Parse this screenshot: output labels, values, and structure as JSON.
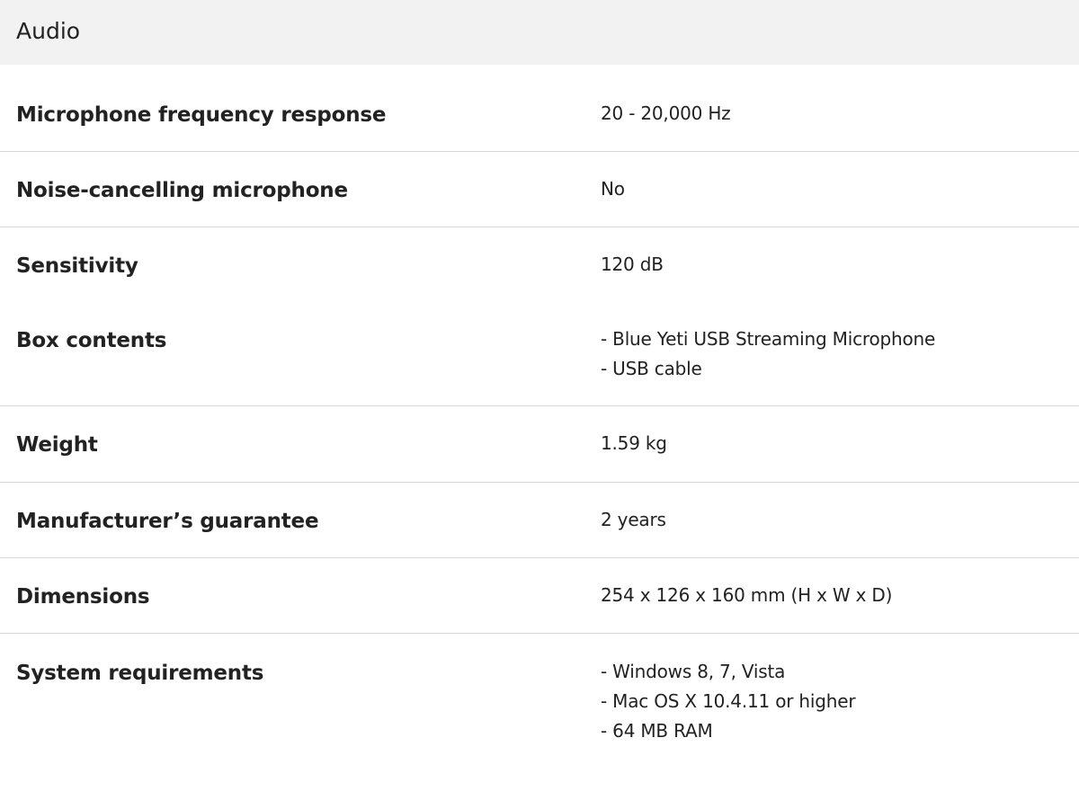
{
  "section": {
    "title": "Audio"
  },
  "specs": [
    {
      "label": "Microphone frequency response",
      "value": "20 - 20,000 Hz"
    },
    {
      "label": "Noise-cancelling microphone",
      "value": "No"
    },
    {
      "label": "Sensitivity",
      "value": "120 dB"
    },
    {
      "label": "Box contents",
      "value": "- Blue Yeti USB Streaming Microphone\n- USB cable"
    },
    {
      "label": "Weight",
      "value": "1.59 kg"
    },
    {
      "label": "Manufacturer’s guarantee",
      "value": "2 years"
    },
    {
      "label": "Dimensions",
      "value": "254 x 126 x 160 mm (H x W x D)"
    },
    {
      "label": "System requirements",
      "value": "- Windows 8, 7, Vista\n- Mac OS X 10.4.11 or higher\n- 64 MB RAM"
    }
  ],
  "colors": {
    "header_background": "#f2f2f2",
    "text": "#222222",
    "divider": "#d6d6d6"
  }
}
